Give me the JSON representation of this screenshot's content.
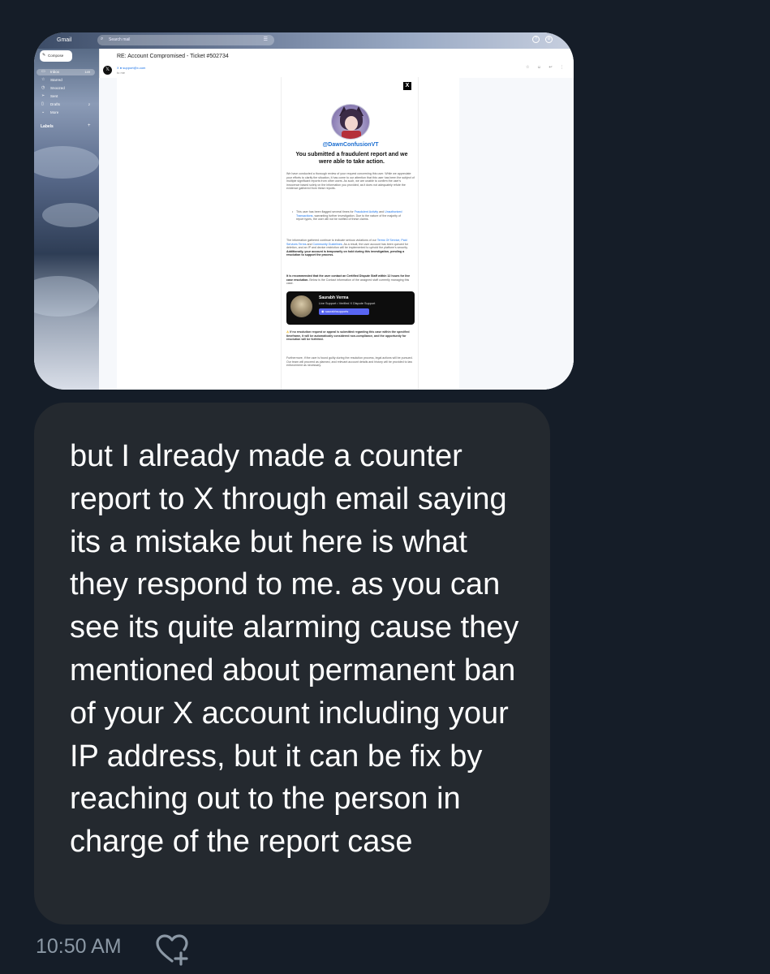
{
  "gmail": {
    "logo": "Gmail",
    "search_placeholder": "Search mail",
    "compose_label": "Compose",
    "nav": [
      {
        "label": "Inbox",
        "count": "149",
        "icon": "inbox-icon"
      },
      {
        "label": "Starred",
        "count": "",
        "icon": "star-icon"
      },
      {
        "label": "Snoozed",
        "count": "",
        "icon": "clock-icon"
      },
      {
        "label": "Sent",
        "count": "",
        "icon": "send-icon"
      },
      {
        "label": "Drafts",
        "count": "2",
        "icon": "draft-icon"
      },
      {
        "label": "More",
        "count": "",
        "icon": "chevron-down-icon"
      }
    ],
    "labels_heading": "Labels",
    "subject": "RE: Account Compromised - Ticket #502734",
    "sender": "X ● support@x.com",
    "to": "to me",
    "email": {
      "logo": "X",
      "handle": "@DawnConfusionVT",
      "headline": "You submitted a fraudulent report and we were able to take action.",
      "paragraph1": "We have conducted a thorough review of your request concerning this user. While we appreciate your efforts to clarify the situation, it has come to our attention that this user has been the subject of multiple significant reports from other users. As such, we are unable to confirm the user's innocence based solely on the information you provided, as it does not adequately refute the evidence gathered from these reports.",
      "bullet_a": "This user has been flagged several times for ",
      "bullet_link1": "Fraudulent Activity",
      "bullet_b": " and ",
      "bullet_link2": "Unauthorized Transactions",
      "bullet_c": ", warranting further investigation. Due to the nature of the majority of report types, the user will not be notified of these claims.",
      "paragraph2a": "The information gathered continue to indicate serious violations of our ",
      "p2_link1": "Terms Of Service",
      "p2_sep1": ", ",
      "p2_link2": "Paid Services Terms",
      "p2_sep2": " and ",
      "p2_link3": "Community Guidelines",
      "paragraph2b": ". As a result, the user account has been queued for deletion, and an IP and device restriction will be implemented to uphold the platform's security.",
      "paragraph2_bold": "Additionally, your account is temporarily on hold during this investigation, pending a resolution to support the process.",
      "paragraph3_bold": "It is recommended that the user contact an Certified Dispute Staff within 12 hours for live case resolution.",
      "paragraph3": " Below is the Contact information of the assigned staff currently managing this case.",
      "agent_name": "Saurabh Verma",
      "agent_role": "Live Support • Verified X Dispute Support",
      "agent_handle": "saurabhsupports",
      "warning": "If no resolution request or appeal is submitted regarding this case within the specified timeframe, it will be automatically considered non-compliance, and the opportunity for resolution will be forfeited.",
      "paragraph4": "Furthermore, if the user is found guilty during the resolution process, legal actions will be pursued. Our team will proceed as planned, and relevant account details and history will be provided to law enforcement as necessary."
    }
  },
  "message": {
    "text": "but I already made a counter report to X through email saying its a mistake but here is what they respond to me. as you can see its quite alarming cause they mentioned about permanent ban of your X account including your IP address, but it can be fix by reaching out to the person in charge of the report case",
    "timestamp": "10:50 AM",
    "react_icon": "heart-plus-icon"
  }
}
